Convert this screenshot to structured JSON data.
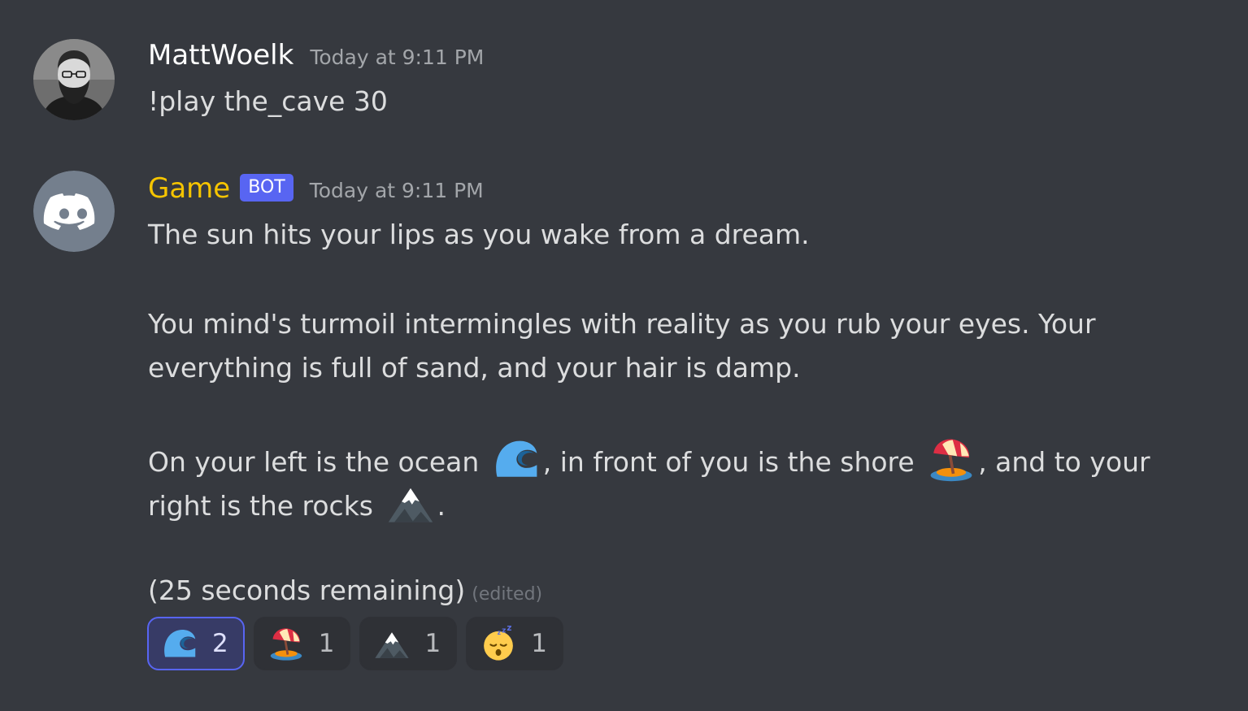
{
  "messages": [
    {
      "username": "MattWoelk",
      "timestamp": "Today at 9:11 PM",
      "text": "!play the_cave 30"
    },
    {
      "username": "Game",
      "badge": "BOT",
      "timestamp": "Today at 9:11 PM",
      "line1": "The sun hits your lips as you wake from a dream.",
      "para2_line1": "You mind's turmoil intermingles with reality as you rub your eyes. Your",
      "para2_line2": "everything is full of sand, and your hair is damp.",
      "para3_seg1": "On your left is the ocean ",
      "para3_seg2": ", in front of you is the shore ",
      "para3_seg3": ", and to your",
      "para4_seg1": "right is the rocks ",
      "para4_seg2": ".",
      "countdown": "(25 seconds remaining)",
      "edited": "(edited)",
      "inline_emojis": [
        "ocean-wave-emoji",
        "beach-umbrella-emoji",
        "snow-capped-mountain-emoji"
      ]
    }
  ],
  "reactions": [
    {
      "emoji": "ocean-wave-emoji",
      "count": "2",
      "selected": true
    },
    {
      "emoji": "beach-umbrella-emoji",
      "count": "1",
      "selected": false
    },
    {
      "emoji": "snow-capped-mountain-emoji",
      "count": "1",
      "selected": false
    },
    {
      "emoji": "sleeping-face-emoji",
      "count": "1",
      "selected": false
    }
  ],
  "colors": {
    "background": "#36393f",
    "bot_username": "#f5c400",
    "bot_badge": "#5865f2",
    "timestamp": "#a3a6aa",
    "text": "#dcddde",
    "reaction_bg": "#2f3136",
    "reaction_selected_border": "#5865f2"
  }
}
